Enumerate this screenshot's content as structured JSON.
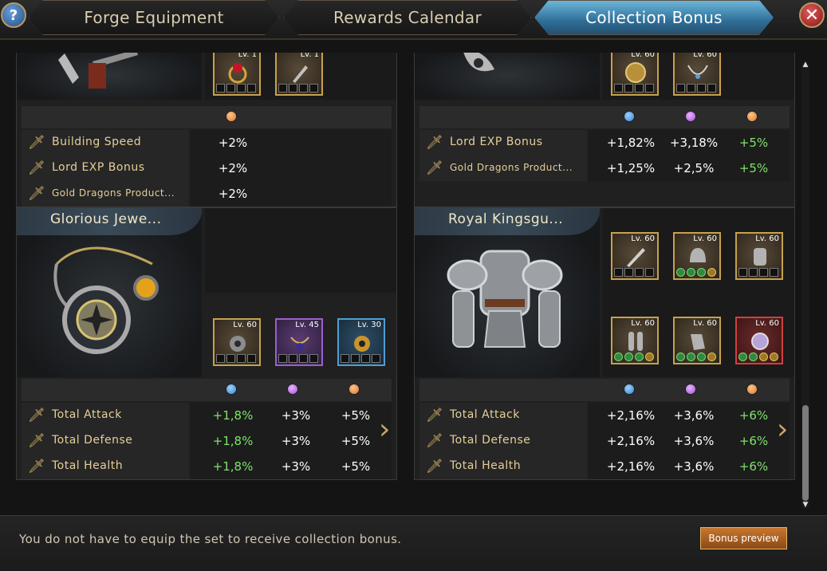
{
  "tabs": [
    {
      "label": "Forge Equipment",
      "active": false
    },
    {
      "label": "Rewards Calendar",
      "active": false
    },
    {
      "label": "Collection Bonus",
      "active": true
    }
  ],
  "help_label": "?",
  "close_label": "✕",
  "left_top": {
    "slots": [
      {
        "level": "Lv. 1",
        "rarity": "gold",
        "icon": "ruby-ring-icon"
      },
      {
        "level": "Lv. 1",
        "rarity": "gold",
        "icon": "dagger-charm-icon"
      }
    ],
    "dot_colors": [
      "orange"
    ],
    "stats": [
      {
        "name": "Building Speed",
        "values": [
          "+2%"
        ]
      },
      {
        "name": "Lord EXP Bonus",
        "values": [
          "+2%"
        ]
      },
      {
        "name": "Gold Dragons Product...",
        "values": [
          "+2%"
        ]
      }
    ]
  },
  "right_top": {
    "slots": [
      {
        "level": "Lv. 60",
        "rarity": "gold",
        "icon": "gold-shield-icon"
      },
      {
        "level": "Lv. 60",
        "rarity": "gold",
        "icon": "silver-necklace-icon"
      }
    ],
    "dot_colors": [
      "blue",
      "purple",
      "orange"
    ],
    "stats": [
      {
        "name": "Lord EXP Bonus",
        "values": [
          "+1,82%",
          "+3,18%",
          "+5%"
        ]
      },
      {
        "name": "Gold Dragons Product...",
        "values": [
          "+1,25%",
          "+2,5%",
          "+5%"
        ]
      }
    ]
  },
  "left_set": {
    "title": "Glorious Jewe...",
    "art": "jeweled-necklace-icon",
    "slots": [
      {
        "level": "Lv. 60",
        "rarity": "gold",
        "icon": "gem-amulet-icon"
      },
      {
        "level": "Lv. 45",
        "rarity": "purple",
        "icon": "pendant-icon"
      },
      {
        "level": "Lv. 30",
        "rarity": "blue",
        "icon": "gold-amulet-icon"
      }
    ],
    "dot_colors": [
      "blue",
      "purple",
      "orange"
    ],
    "stats": [
      {
        "name": "Total Attack",
        "values": [
          "+1,8%",
          "+3%",
          "+5%"
        ]
      },
      {
        "name": "Total Defense",
        "values": [
          "+1,8%",
          "+3%",
          "+5%"
        ]
      },
      {
        "name": "Total Health",
        "values": [
          "+1,8%",
          "+3%",
          "+5%"
        ]
      }
    ]
  },
  "right_set": {
    "title": "Royal Kingsgu...",
    "art": "plate-armor-icon",
    "slots": [
      {
        "level": "Lv. 60",
        "rarity": "gold",
        "icon": "sword-icon"
      },
      {
        "level": "Lv. 60",
        "rarity": "gold",
        "icon": "helmet-icon"
      },
      {
        "level": "Lv. 60",
        "rarity": "gold",
        "icon": "breastplate-icon"
      },
      {
        "level": "Lv. 60",
        "rarity": "gold",
        "icon": "greaves-icon"
      },
      {
        "level": "Lv. 60",
        "rarity": "gold",
        "icon": "gauntlet-icon"
      },
      {
        "level": "Lv. 60",
        "rarity": "red",
        "icon": "orb-amulet-icon"
      }
    ],
    "dot_colors": [
      "blue",
      "purple",
      "orange"
    ],
    "stats": [
      {
        "name": "Total Attack",
        "values": [
          "+2,16%",
          "+3,6%",
          "+6%"
        ]
      },
      {
        "name": "Total Defense",
        "values": [
          "+2,16%",
          "+3,6%",
          "+6%"
        ]
      },
      {
        "name": "Total Health",
        "values": [
          "+2,16%",
          "+3,6%",
          "+6%"
        ]
      }
    ]
  },
  "footer": {
    "note": "You do not have to equip the set to receive collection bonus.",
    "button_label": "Bonus preview"
  },
  "colors": {
    "accent_gold": "#c7a14e",
    "green_value": "#7ee26b",
    "tab_active": "#4c95bf",
    "button_orange": "#b0662a"
  }
}
